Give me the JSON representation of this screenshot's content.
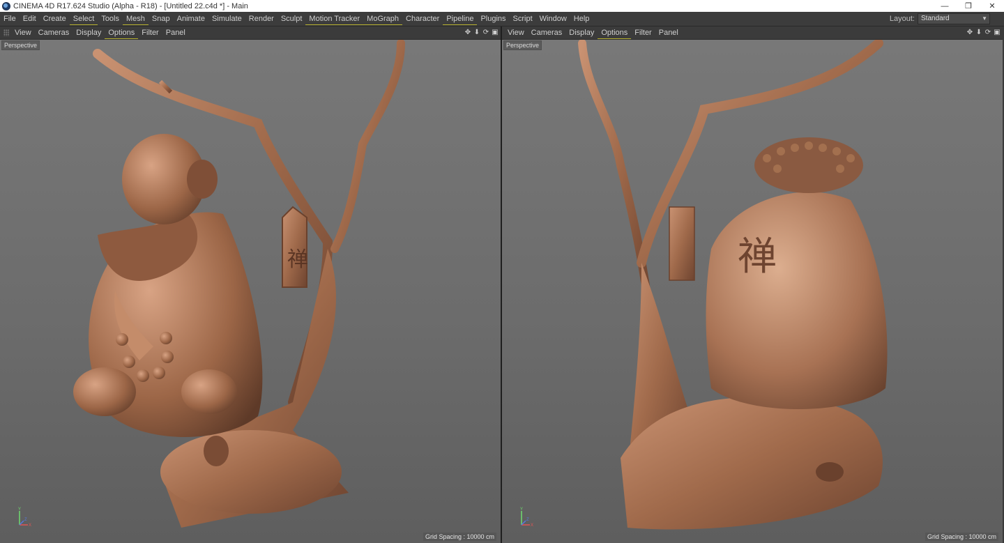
{
  "window": {
    "title": "CINEMA 4D R17.624 Studio (Alpha - R18) - [Untitled 22.c4d *] - Main",
    "controls": [
      "—",
      "❐",
      "✕"
    ]
  },
  "menu": {
    "items": [
      "File",
      "Edit",
      "Create",
      "Select",
      "Tools",
      "Mesh",
      "Snap",
      "Animate",
      "Simulate",
      "Render",
      "Sculpt",
      "Motion Tracker",
      "MoGraph",
      "Character",
      "Pipeline",
      "Plugins",
      "Script",
      "Window",
      "Help"
    ],
    "layout_label": "Layout:",
    "layout_value": "Standard"
  },
  "viewports": [
    {
      "menu": [
        "View",
        "Cameras",
        "Display",
        "Options",
        "Filter",
        "Panel"
      ],
      "camera": "Perspective",
      "grid_spacing": "Grid Spacing : 10000 cm",
      "icons": [
        "move-icon",
        "down-arrow-icon",
        "rotate-icon",
        "maximize-icon"
      ]
    },
    {
      "menu": [
        "View",
        "Cameras",
        "Display",
        "Options",
        "Filter",
        "Panel"
      ],
      "camera": "Perspective",
      "grid_spacing": "Grid Spacing : 10000 cm",
      "icons": [
        "move-icon",
        "down-arrow-icon",
        "rotate-icon",
        "maximize-icon"
      ]
    }
  ],
  "colors": {
    "accent_underline": "#b7b230",
    "bronze": "#a8714f"
  }
}
